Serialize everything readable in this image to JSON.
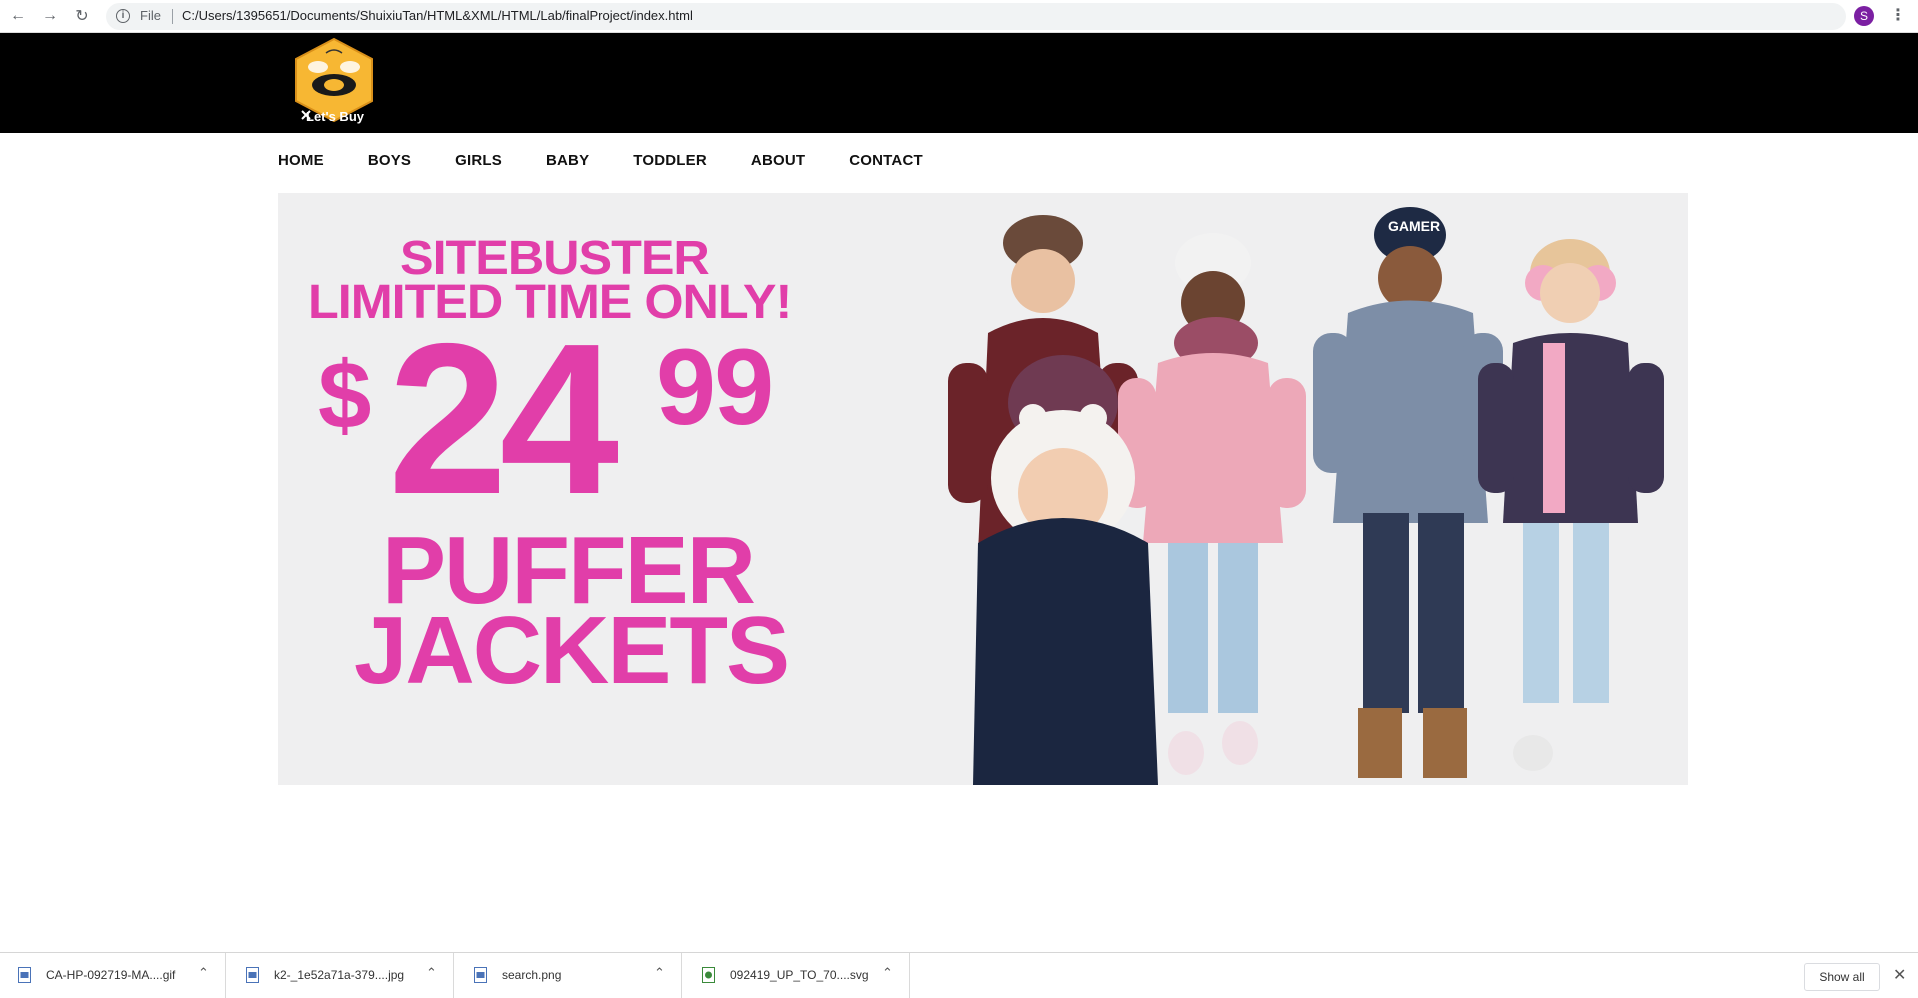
{
  "browser": {
    "file_label": "File",
    "url": "C:/Users/1395651/Documents/ShuixiuTan/HTML&XML/HTML/Lab/finalProject/index.html",
    "profile_initial": "S",
    "icons": {
      "back": "arrow-left-icon",
      "forward": "arrow-right-icon",
      "reload": "reload-icon",
      "info": "info-icon",
      "bookmark": "star-icon",
      "menu": "kebab-menu-icon"
    }
  },
  "site": {
    "logo_text": "Let's Buy",
    "nav": [
      "HOME",
      "BOYS",
      "GIRLS",
      "BABY",
      "TODDLER",
      "ABOUT",
      "CONTACT"
    ]
  },
  "hero": {
    "line1": "SITEBUSTER",
    "line2": "LIMITED TIME ONLY!",
    "dollar": "$",
    "price_main": "24",
    "price_cents": "99",
    "product_line1": "PUFFER",
    "product_line2": "JACKETS",
    "accent_color": "#e13ea9",
    "hat_text": "GAMER"
  },
  "downloads": {
    "items": [
      "CA-HP-092719-MA....gif",
      "k2-_1e52a71a-379....jpg",
      "search.png",
      "092419_UP_TO_70....svg"
    ],
    "show_all": "Show all"
  }
}
